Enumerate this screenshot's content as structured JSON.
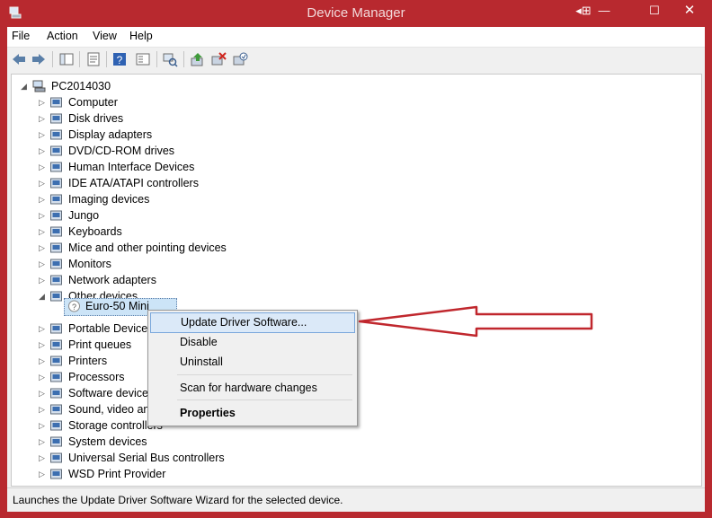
{
  "window": {
    "title": "Device Manager",
    "controls": [
      "minimize",
      "maximize",
      "close"
    ]
  },
  "menu": [
    "File",
    "Action",
    "View",
    "Help"
  ],
  "toolbar": [
    {
      "name": "back-icon"
    },
    {
      "name": "forward-icon"
    },
    {
      "name": "show-hide-tree-icon"
    },
    {
      "name": "properties-icon"
    },
    {
      "name": "help-icon"
    },
    {
      "name": "view-icon"
    },
    {
      "name": "scan-hardware-icon"
    },
    {
      "name": "update-driver-icon"
    },
    {
      "name": "uninstall-icon"
    },
    {
      "name": "enable-icon"
    }
  ],
  "tree": {
    "root": "PC2014030",
    "items": [
      {
        "label": "Computer",
        "expanded": false,
        "icon": "computer-icon"
      },
      {
        "label": "Disk drives",
        "expanded": false,
        "icon": "disk-icon"
      },
      {
        "label": "Display adapters",
        "expanded": false,
        "icon": "display-icon"
      },
      {
        "label": "DVD/CD-ROM drives",
        "expanded": false,
        "icon": "dvd-icon"
      },
      {
        "label": "Human Interface Devices",
        "expanded": false,
        "icon": "hid-icon"
      },
      {
        "label": "IDE ATA/ATAPI controllers",
        "expanded": false,
        "icon": "ide-icon"
      },
      {
        "label": "Imaging devices",
        "expanded": false,
        "icon": "camera-icon"
      },
      {
        "label": "Jungo",
        "expanded": false,
        "icon": "jungo-icon"
      },
      {
        "label": "Keyboards",
        "expanded": false,
        "icon": "keyboard-icon"
      },
      {
        "label": "Mice and other pointing devices",
        "expanded": false,
        "icon": "mouse-icon"
      },
      {
        "label": "Monitors",
        "expanded": false,
        "icon": "monitor-icon"
      },
      {
        "label": "Network adapters",
        "expanded": false,
        "icon": "network-icon"
      },
      {
        "label": "Other devices",
        "expanded": true,
        "icon": "unknown-device-icon"
      },
      {
        "label": "Portable Devices",
        "expanded": false,
        "icon": "portable-icon"
      },
      {
        "label": "Print queues",
        "expanded": false,
        "icon": "printer-icon"
      },
      {
        "label": "Printers",
        "expanded": false,
        "icon": "printer-icon"
      },
      {
        "label": "Processors",
        "expanded": false,
        "icon": "processor-icon"
      },
      {
        "label": "Software devices",
        "expanded": false,
        "icon": "software-icon"
      },
      {
        "label": "Sound, video and",
        "expanded": false,
        "icon": "sound-icon"
      },
      {
        "label": "Storage controllers",
        "expanded": false,
        "icon": "storage-icon"
      },
      {
        "label": "System devices",
        "expanded": false,
        "icon": "system-icon"
      },
      {
        "label": "Universal Serial Bus controllers",
        "expanded": false,
        "icon": "usb-icon"
      },
      {
        "label": "WSD Print Provider",
        "expanded": false,
        "icon": "printer-icon"
      }
    ],
    "selected_child": "Euro-50 Mini"
  },
  "context_menu": {
    "items": [
      {
        "label": "Update Driver Software...",
        "highlighted": true
      },
      {
        "label": "Disable"
      },
      {
        "label": "Uninstall"
      },
      {
        "label": "Scan for hardware changes"
      },
      {
        "label": "Properties",
        "bold": true
      }
    ]
  },
  "status": "Launches the Update Driver Software Wizard for the selected device.",
  "colors": {
    "titlebar": "#b8292f",
    "arrow": "#c0272d",
    "highlight": "#dbe9f8"
  }
}
